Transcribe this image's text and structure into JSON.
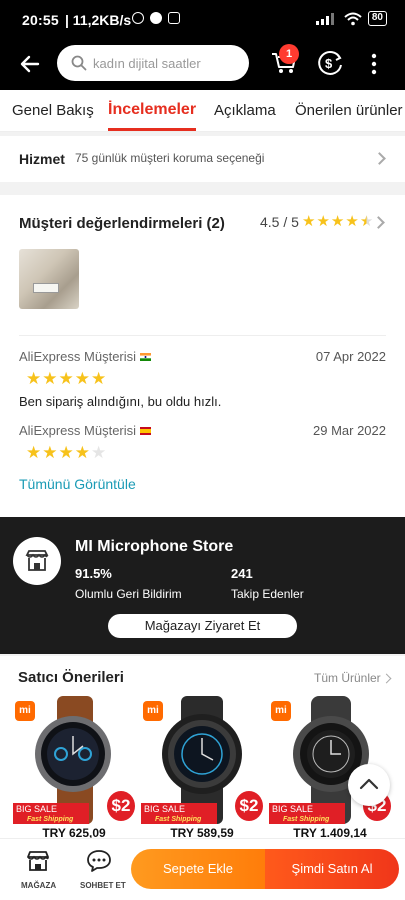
{
  "status_bar": {
    "time": "20:55",
    "speed": "| 11,2KB/s",
    "battery": "80"
  },
  "header": {
    "search_placeholder": "kadın dijital saatler",
    "cart_count": "1"
  },
  "tabs": [
    {
      "label": "Genel Bakış",
      "active": false
    },
    {
      "label": "İncelemeler",
      "active": true
    },
    {
      "label": "Açıklama",
      "active": false
    },
    {
      "label": "Önerilen ürünler",
      "active": false
    }
  ],
  "service": {
    "label": "Hizmet",
    "text": "75 günlük müşteri koruma seçeneği"
  },
  "reviews": {
    "title": "Müşteri değerlendirmeleri (2)",
    "score": "4.5 / 5",
    "rating": 4.5,
    "view_all": "Tümünü Görüntüle",
    "items": [
      {
        "name": "AliExpress Müşterisi",
        "country": "India",
        "date": "07 Apr 2022",
        "stars": 5,
        "text": "Ben sipariş alındığını, bu oldu hızlı."
      },
      {
        "name": "AliExpress Müşterisi",
        "country": "Spain",
        "date": "29 Mar 2022",
        "stars": 4,
        "text": ""
      }
    ]
  },
  "store": {
    "name": "MI Microphone Store",
    "positive_value": "91.5%",
    "positive_label": "Olumlu Geri Bildirim",
    "followers_value": "241",
    "followers_label": "Takip Edenler",
    "visit_button": "Mağazayı Ziyaret Et"
  },
  "recommendations": {
    "title": "Satıcı Önerileri",
    "all_products": "Tüm Ürünler",
    "badge": {
      "mi": "mi",
      "big_sale": "BIG SALE",
      "fast_shipping": "Fast Shipping",
      "off": "$2"
    },
    "items": [
      {
        "price": "TRY 625,09",
        "strap_color": "#8a4a22"
      },
      {
        "price": "TRY 589,59",
        "strap_color": "#2b2b2b"
      },
      {
        "price": "TRY 1.409,14",
        "strap_color": "#3a3a3a"
      }
    ]
  },
  "bottom_bar": {
    "store_label": "MAĞAZA",
    "chat_label": "SOHBET ET",
    "add_to_cart": "Sepete Ekle",
    "buy_now": "Şimdi Satın Al"
  },
  "colors": {
    "accent_red": "#e62e1f",
    "link_teal": "#1a9bb5",
    "star_yellow": "#f7c21b",
    "add_cart_orange": "#ff8a12",
    "buy_now_red": "#f0361a"
  }
}
